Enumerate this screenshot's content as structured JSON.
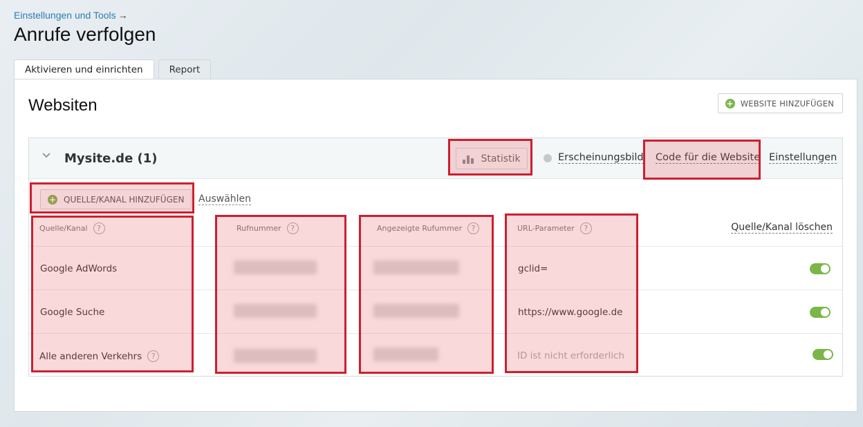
{
  "breadcrumb": {
    "label": "Einstellungen und Tools",
    "arrow": "→"
  },
  "page_title": "Anrufe verfolgen",
  "tabs": [
    {
      "label": "Aktivieren und einrichten",
      "active": true
    },
    {
      "label": "Report",
      "active": false
    }
  ],
  "section": {
    "title": "Websiten",
    "add_website_label": "WEBSITE HINZUFÜGEN"
  },
  "site": {
    "name": "Mysite.de (1)",
    "statistik_label": "Statistik",
    "links": {
      "appearance": "Erscheinungsbild",
      "code": "Code für die Website",
      "settings": "Einstellungen"
    },
    "add_source_label": "QUELLE/KANAL HINZUFÜGEN",
    "select_label": "Auswählen",
    "columns": {
      "source": "Quelle/Kanal",
      "phone": "Rufnummer",
      "displayed_phone": "Angezeigte Rufummer",
      "url_param": "URL-Parameter",
      "delete": "Quelle/Kanal löschen"
    },
    "rows": [
      {
        "source": "Google AdWords",
        "url_param": "gclid=",
        "url_muted": false,
        "enabled": true,
        "help": false
      },
      {
        "source": "Google Suche",
        "url_param": "https://www.google.de",
        "url_muted": false,
        "enabled": true,
        "help": false
      },
      {
        "source": "Alle anderen Verkehrs",
        "url_param": "ID ist nicht erforderlich",
        "url_muted": true,
        "enabled": true,
        "help": true
      }
    ]
  },
  "colors": {
    "accent_green": "#7ab648",
    "link_blue": "#2a7fb0",
    "highlight_red": "#cc1f2e"
  },
  "icons": {
    "help": "?",
    "plus": "+"
  }
}
